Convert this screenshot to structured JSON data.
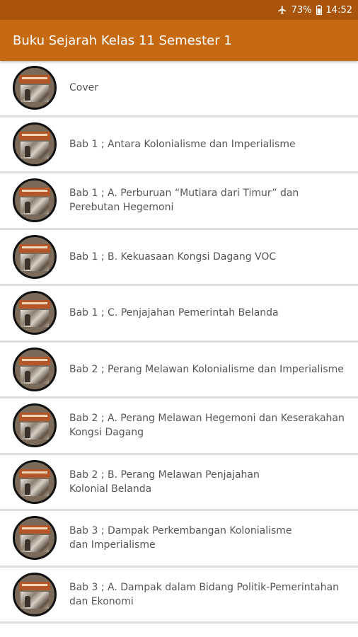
{
  "status_bar": {
    "airplane_icon": "airplane-icon",
    "battery_percent": "73%",
    "battery_icon": "battery-icon",
    "time": "14:52"
  },
  "app_bar": {
    "title": "Buku Sejarah Kelas 11 Semester 1"
  },
  "colors": {
    "status_bar": "#a8540c",
    "app_bar": "#c56a12",
    "divider": "#dedede",
    "text": "#555555"
  },
  "items": [
    {
      "label": "Cover"
    },
    {
      "label": "Bab 1 ; Antara Kolonialisme dan Imperialisme"
    },
    {
      "label": "Bab 1 ; A. Perburuan “Mutiara dari Timur” dan\nPerebutan Hegemoni"
    },
    {
      "label": "Bab 1 ; B. Kekuasaan Kongsi Dagang VOC"
    },
    {
      "label": "Bab 1 ; C. Penjajahan Pemerintah Belanda"
    },
    {
      "label": "Bab 2 ; Perang Melawan Kolonialisme dan Imperialisme"
    },
    {
      "label": "Bab 2 ; A. Perang Melawan Hegemoni dan Keserakahan\nKongsi Dagang"
    },
    {
      "label": "Bab 2 ; B. Perang Melawan Penjajahan\nKolonial Belanda"
    },
    {
      "label": "Bab 3 ; Dampak Perkembangan Kolonialisme\ndan Imperialisme"
    },
    {
      "label": "Bab 3 ; A. Dampak dalam Bidang Politik-Pemerintahan\ndan Ekonomi"
    }
  ]
}
